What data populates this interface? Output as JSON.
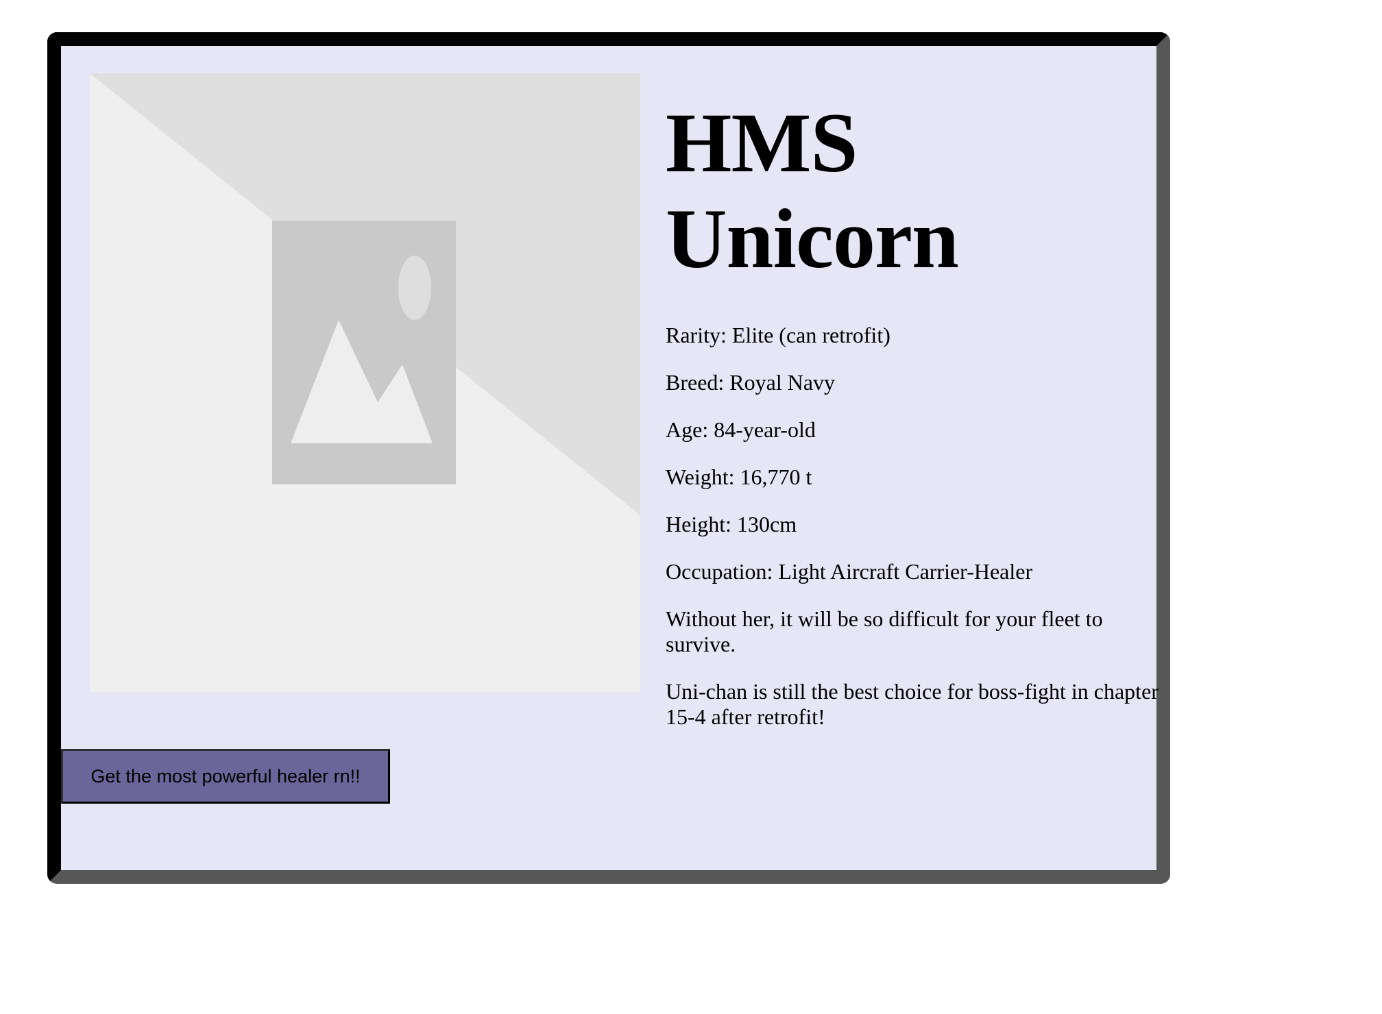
{
  "card": {
    "title_line1": "HMS",
    "title_line2": "Unicorn",
    "fields": [
      {
        "label": "Rarity: Elite (can retrofit)"
      },
      {
        "label": "Breed: Royal Navy"
      },
      {
        "label": "Age: 84-year-old"
      },
      {
        "label": "Weight: 16,770 t"
      },
      {
        "label": "Height: 130cm"
      },
      {
        "label": "Occupation: Light Aircraft Carrier-Healer"
      }
    ],
    "description": [
      "Without her, it will be so difficult for your fleet to survive.",
      "Uni-chan is still the best choice for boss-fight in chapter 15-4 after retrofit!"
    ],
    "cta_label": "Get the most powerful healer rn!!"
  },
  "image": {
    "icon": "image-placeholder-icon"
  },
  "colors": {
    "card_background": "#e6e6f6",
    "button_background": "#6b659a",
    "border_dark": "#000000",
    "border_shadow": "#575757"
  }
}
